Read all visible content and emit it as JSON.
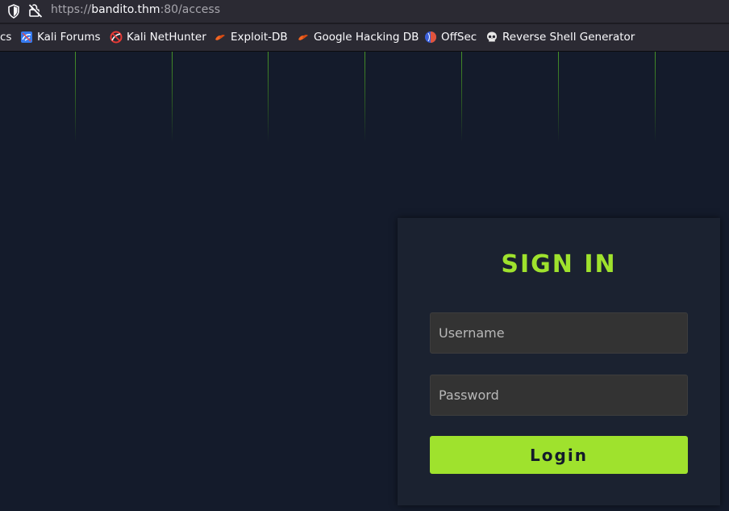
{
  "browser": {
    "url_scheme": "https://",
    "url_host": "bandito.thm",
    "url_rest": ":80/access",
    "bookmarks": [
      {
        "label": "cs",
        "icon": "truncated"
      },
      {
        "label": "Kali Forums",
        "icon": "kali-forums-icon"
      },
      {
        "label": "Kali NetHunter",
        "icon": "kali-nethunter-icon"
      },
      {
        "label": "Exploit-DB",
        "icon": "exploit-db-icon"
      },
      {
        "label": "Google Hacking DB",
        "icon": "google-hacking-db-icon"
      },
      {
        "label": "OffSec",
        "icon": "offsec-icon"
      },
      {
        "label": "Reverse Shell Generator",
        "icon": "skull-icon"
      }
    ]
  },
  "login": {
    "title": "SIGN IN",
    "username_placeholder": "Username",
    "password_placeholder": "Password",
    "button_label": "Login"
  },
  "colors": {
    "accent": "#9fe22d",
    "page_bg": "#141b2b",
    "card_bg": "#1b2230",
    "field_bg": "#333333"
  }
}
